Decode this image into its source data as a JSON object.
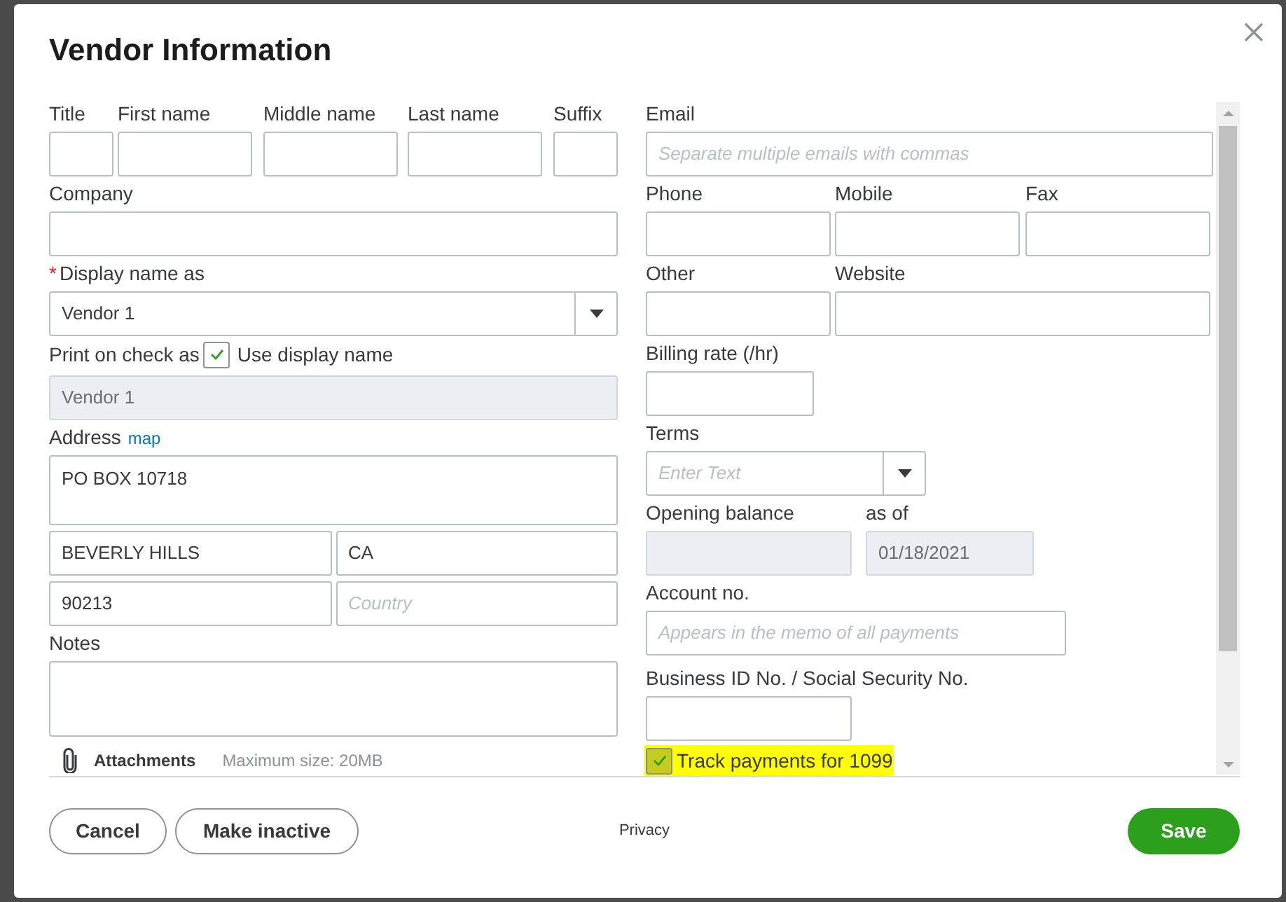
{
  "dialog": {
    "title": "Vendor Information"
  },
  "left_column": {
    "name_fields": [
      {
        "label": "Title"
      },
      {
        "label": "First name"
      },
      {
        "label": "Middle name"
      },
      {
        "label": "Last name"
      },
      {
        "label": "Suffix"
      }
    ],
    "company": {
      "label": "Company"
    },
    "display_name": {
      "required_mark": "*",
      "label": "Display name as",
      "value": "Vendor 1"
    },
    "print_on_check": {
      "label": "Print on check as",
      "checkbox": {
        "label": "Use display name",
        "checked": true
      },
      "field": {
        "value": "Vendor 1",
        "disabled": true
      }
    },
    "address": {
      "label": "Address",
      "link": "map",
      "street": "PO BOX 10718",
      "city": "BEVERLY HILLS",
      "state": "CA",
      "zip": "90213",
      "country": {
        "placeholder": "Country"
      }
    },
    "notes": {
      "label": "Notes"
    },
    "attachments": {
      "label": "Attachments",
      "note": "Maximum size: 20MB"
    }
  },
  "right_column": {
    "email": {
      "label": "Email",
      "placeholder": "Separate multiple emails with commas"
    },
    "phone_fields": [
      {
        "label": "Phone"
      },
      {
        "label": "Mobile"
      },
      {
        "label": "Fax"
      }
    ],
    "other_fields": [
      {
        "label": "Other"
      },
      {
        "label": "Website"
      }
    ],
    "billing_rate": {
      "label": "Billing rate (/hr)"
    },
    "terms": {
      "label": "Terms",
      "placeholder": "Enter Text"
    },
    "opening_balance": {
      "label": "Opening balance",
      "disabled": true
    },
    "as_of": {
      "label": "as of",
      "value": "01/18/2021",
      "disabled": true
    },
    "account_no": {
      "label": "Account no.",
      "placeholder": "Appears in the memo of all payments"
    },
    "business_id": {
      "label": "Business ID No. / Social Security No."
    },
    "track_1099": {
      "label": "Track payments for 1099",
      "checked": true,
      "highlighted": true
    }
  },
  "footer": {
    "buttons": [
      {
        "label": "Cancel"
      },
      {
        "label": "Make inactive"
      }
    ],
    "link": "Privacy",
    "save_button": "Save"
  }
}
